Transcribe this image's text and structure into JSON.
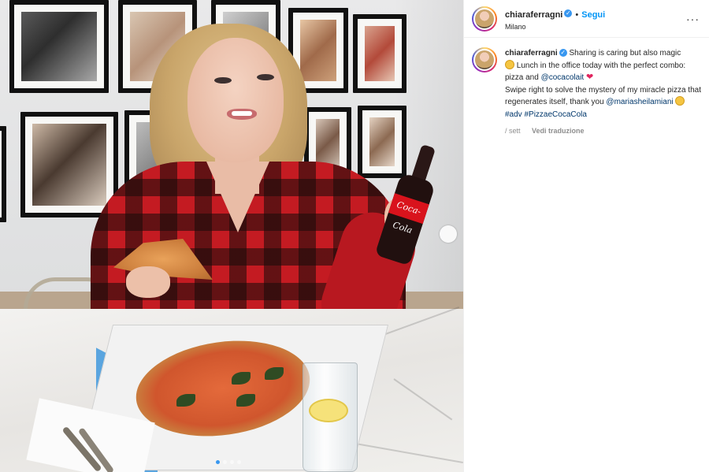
{
  "header": {
    "username": "chiaraferragni",
    "separator": "•",
    "follow_label": "Segui",
    "location": "Milano",
    "more_glyph": "···"
  },
  "caption": {
    "username": "chiaraferragni",
    "line1": "Sharing is caring but also magic",
    "line2a": "Lunch in the office today with the perfect combo: pizza and",
    "mention1": "@cocacolait",
    "line3": "Swipe right to solve the mystery of my miracle pizza that regenerates itself, thank you",
    "mention2": "@mariasheilamiani",
    "hashtag1": "#adv",
    "hashtag2": "#PizzaeCocaCola",
    "emoji_smile": "smiling-face",
    "emoji_heart": "❤",
    "emoji_laugh": "laughing-face"
  },
  "meta": {
    "time": "/ sett",
    "translate_label": "Vedi traduzione"
  },
  "photo": {
    "bottle_label": "Coca-Cola",
    "carousel": {
      "count": 4,
      "active_index": 0
    }
  },
  "colors": {
    "accent": "#0095f6",
    "verified": "#3897f0",
    "mention": "#00376b",
    "heart": "#e0245e",
    "sweater_red": "#c41b22"
  },
  "icons": {
    "verified": "verified-badge-icon",
    "more": "more-options-icon",
    "next": "next-arrow-icon"
  }
}
